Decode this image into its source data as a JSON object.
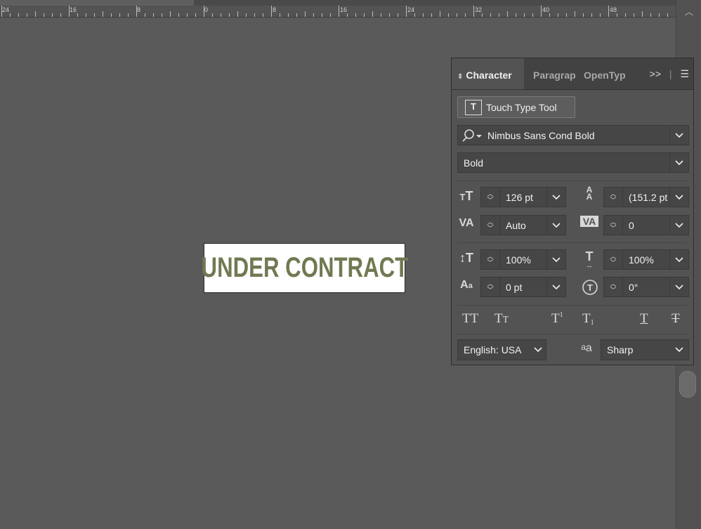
{
  "ruler": {
    "labels": [
      "24",
      "16",
      "8",
      "0",
      "8",
      "16",
      "24",
      "32",
      "40",
      "48"
    ]
  },
  "artboard": {
    "text": "UNDER CONTRACT",
    "text_color": "#707a52"
  },
  "panel": {
    "tabs": [
      {
        "label": "Character",
        "active": true
      },
      {
        "label": "Paragrap",
        "active": false
      },
      {
        "label": "OpenTyp",
        "active": false
      }
    ],
    "touch_type_button": "Touch Type Tool",
    "font_family": "Nimbus Sans Cond Bold",
    "font_style": "Bold",
    "font_size": "126 pt",
    "leading": "(151.2 pt",
    "kerning": "Auto",
    "tracking": "0",
    "vertical_scale": "100%",
    "horizontal_scale": "100%",
    "baseline_shift": "0 pt",
    "rotation": "0°",
    "language": "English: USA",
    "antialias": "Sharp"
  },
  "icons": {
    "search": "search-icon",
    "chevron": "chevron-down-icon",
    "menu": "hamburger-menu-icon",
    "collapse": "double-chevron-right-icon"
  }
}
